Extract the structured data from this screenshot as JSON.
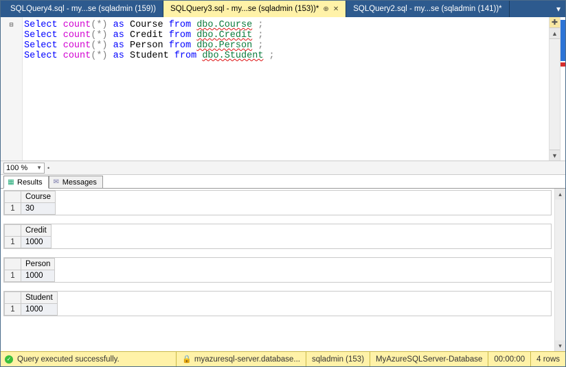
{
  "tabs": [
    {
      "label": "SQLQuery4.sql - my...se (sqladmin (159))",
      "active": false,
      "modified": false
    },
    {
      "label": "SQLQuery3.sql - my...se (sqladmin (153))*",
      "active": true,
      "modified": true
    },
    {
      "label": "SQLQuery2.sql - my...se (sqladmin (141))*",
      "active": false,
      "modified": true
    }
  ],
  "editor": {
    "lines": [
      {
        "kw1": "Select",
        "fn": "count",
        "op1": "(*)",
        "kw2": "as",
        "alias": "Course",
        "kw3": "from",
        "obj": "dbo.Course",
        "end": " ;"
      },
      {
        "kw1": "Select",
        "fn": "count",
        "op1": "(*)",
        "kw2": "as",
        "alias": "Credit",
        "kw3": "from",
        "obj": "dbo.Credit",
        "end": " ;"
      },
      {
        "kw1": "Select",
        "fn": "count",
        "op1": "(*)",
        "kw2": "as",
        "alias": "Person",
        "kw3": "from",
        "obj": "dbo.Person",
        "end": " ;"
      },
      {
        "kw1": "Select",
        "fn": "count",
        "op1": "(*)",
        "kw2": "as",
        "alias": "Student",
        "kw3": "from",
        "obj": "dbo.Student",
        "end": " ;"
      }
    ]
  },
  "zoom": {
    "value": "100 %"
  },
  "results_tabs": {
    "results": "Results",
    "messages": "Messages"
  },
  "results": [
    {
      "column": "Course",
      "rownum": "1",
      "value": "30"
    },
    {
      "column": "Credit",
      "rownum": "1",
      "value": "1000"
    },
    {
      "column": "Person",
      "rownum": "1",
      "value": "1000"
    },
    {
      "column": "Student",
      "rownum": "1",
      "value": "1000"
    }
  ],
  "status": {
    "message": "Query executed successfully.",
    "server": "myazuresql-server.database...",
    "user": "sqladmin (153)",
    "db": "MyAzureSQLServer-Database",
    "elapsed": "00:00:00",
    "rows": "4 rows"
  }
}
